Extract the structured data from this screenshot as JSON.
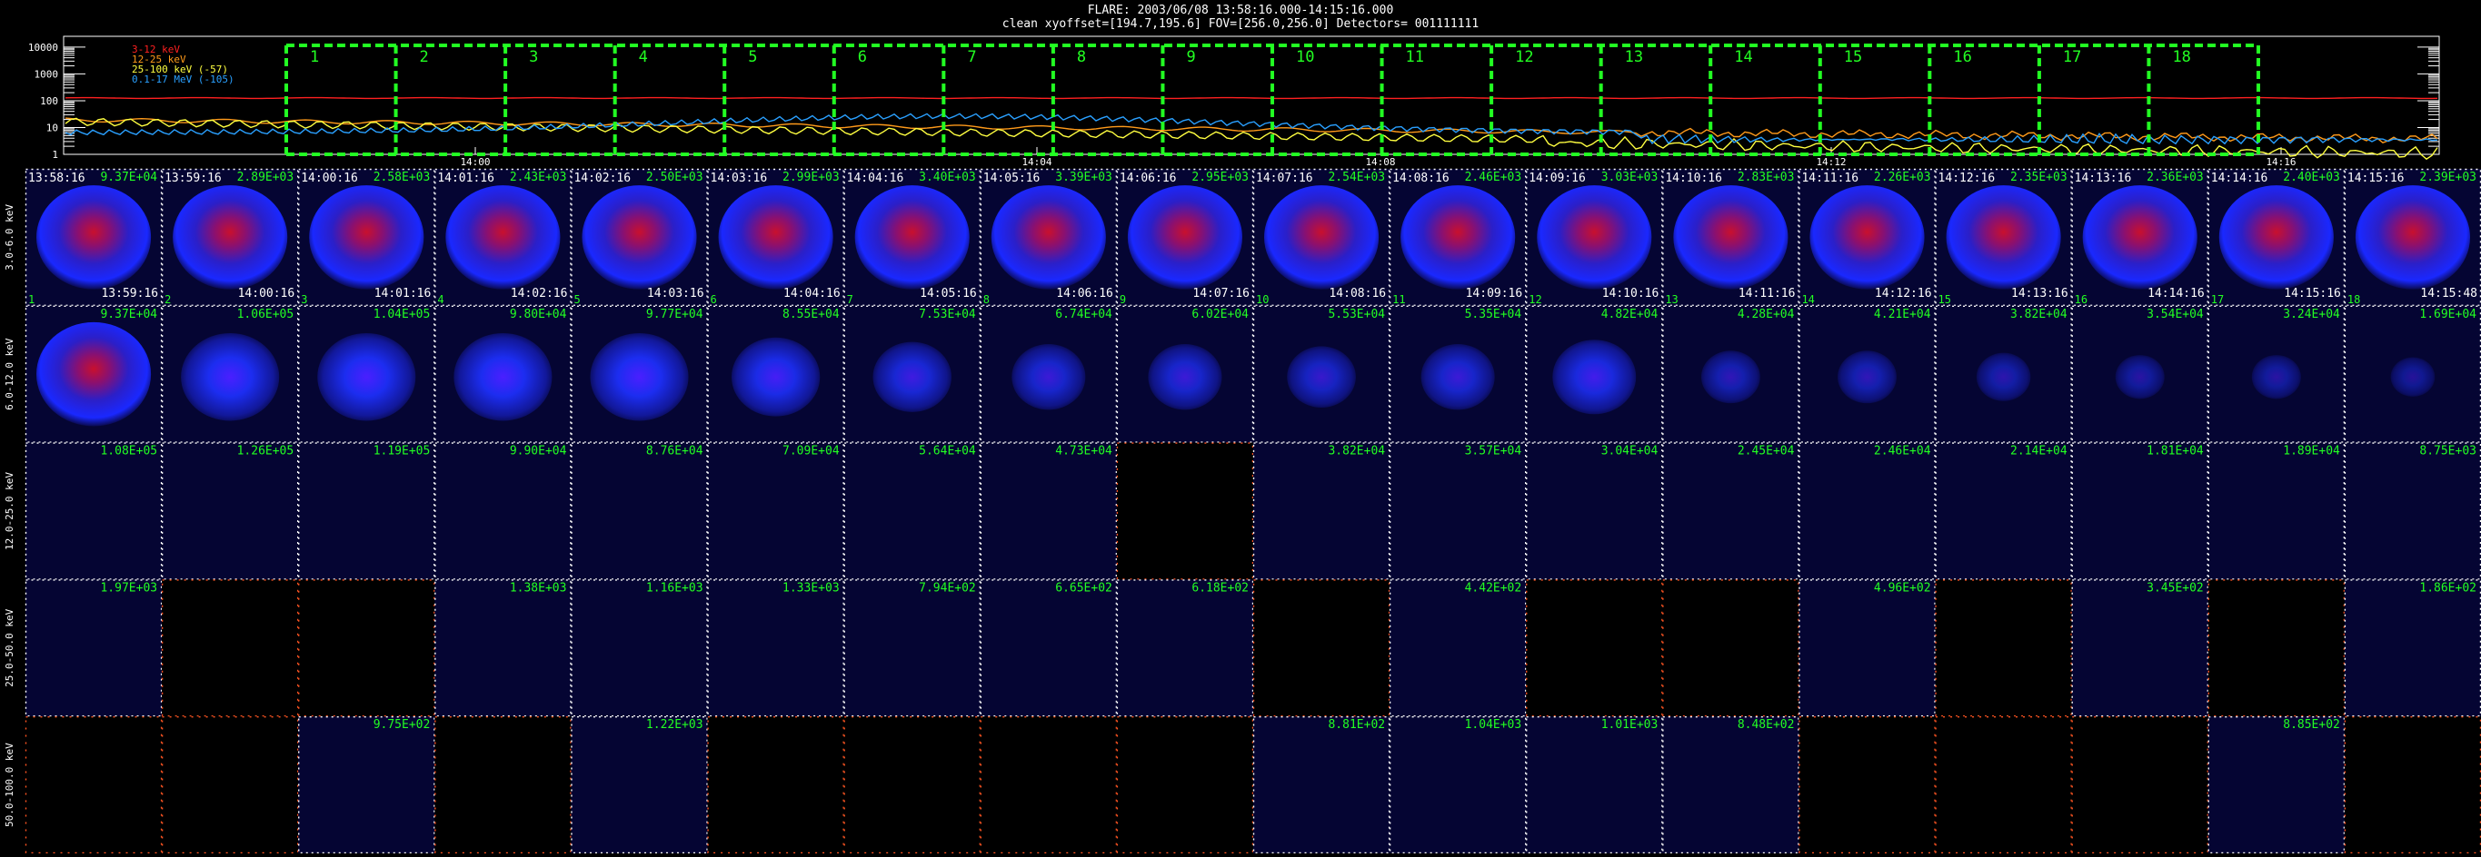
{
  "header": {
    "title_line": "FLARE: 2003/06/08 13:58:16.000-14:15:16.000",
    "info_line": "clean    xyoffset=[194.7,195.6]    FOV=[256.0,256.0]    Detectors= 001111111"
  },
  "lightcurve": {
    "y_ticks": [
      "10000",
      "1000",
      "100",
      "10",
      "1"
    ],
    "x_ticks": [
      "14:00",
      "14:04",
      "14:08",
      "14:12",
      "14:16"
    ],
    "legend": [
      {
        "label": "3-12 keV",
        "color": "#ff2020"
      },
      {
        "label": "12-25 keV",
        "color": "#ff9a1a"
      },
      {
        "label": "25-100 keV (-57)",
        "color": "#ffff40"
      },
      {
        "label": "0.1-17 MeV (-105)",
        "color": "#2aa0ff"
      }
    ],
    "interval_labels": [
      "1",
      "2",
      "3",
      "4",
      "5",
      "6",
      "7",
      "8",
      "9",
      "10",
      "11",
      "12",
      "13",
      "14",
      "15",
      "16",
      "17",
      "18"
    ],
    "interval_color": "#22ff22"
  },
  "grid": {
    "frame_color": "#ffffff",
    "value_color": "#22ff22",
    "empty_frame_color": "#ff5522",
    "start_times": [
      "13:58:16",
      "13:59:16",
      "14:00:16",
      "14:01:16",
      "14:02:16",
      "14:03:16",
      "14:04:16",
      "14:05:16",
      "14:06:16",
      "14:07:16",
      "14:08:16",
      "14:09:16",
      "14:10:16",
      "14:11:16",
      "14:12:16",
      "14:13:16",
      "14:14:16",
      "14:15:16"
    ],
    "end_times": [
      "13:59:16",
      "14:00:16",
      "14:01:16",
      "14:02:16",
      "14:03:16",
      "14:04:16",
      "14:05:16",
      "14:06:16",
      "14:07:16",
      "14:08:16",
      "14:09:16",
      "14:10:16",
      "14:11:16",
      "14:12:16",
      "14:13:16",
      "14:14:16",
      "14:15:16",
      "14:15:48"
    ],
    "rows": [
      {
        "label": "3.0-6.0 keV",
        "cells": [
          {
            "v": "9.37E+04",
            "brightness": 1.0
          },
          {
            "v": "2.89E+03",
            "brightness": 1.0
          },
          {
            "v": "2.58E+03",
            "brightness": 1.0
          },
          {
            "v": "2.43E+03",
            "brightness": 1.0
          },
          {
            "v": "2.50E+03",
            "brightness": 1.0
          },
          {
            "v": "2.99E+03",
            "brightness": 1.0
          },
          {
            "v": "3.40E+03",
            "brightness": 1.0
          },
          {
            "v": "3.39E+03",
            "brightness": 1.0
          },
          {
            "v": "2.95E+03",
            "brightness": 1.0
          },
          {
            "v": "2.54E+03",
            "brightness": 1.0
          },
          {
            "v": "2.46E+03",
            "brightness": 1.0
          },
          {
            "v": "3.03E+03",
            "brightness": 1.0
          },
          {
            "v": "2.83E+03",
            "brightness": 1.0
          },
          {
            "v": "2.26E+03",
            "brightness": 1.0
          },
          {
            "v": "2.35E+03",
            "brightness": 1.0
          },
          {
            "v": "2.36E+03",
            "brightness": 1.0
          },
          {
            "v": "2.40E+03",
            "brightness": 1.0
          },
          {
            "v": "2.39E+03",
            "brightness": 1.0
          }
        ]
      },
      {
        "label": "6.0-12.0 keV",
        "cells": [
          {
            "v": "9.37E+04",
            "brightness": 0.95
          },
          {
            "v": "1.06E+05",
            "brightness": 0.85
          },
          {
            "v": "1.04E+05",
            "brightness": 0.8
          },
          {
            "v": "9.80E+04",
            "brightness": 0.75
          },
          {
            "v": "9.77E+04",
            "brightness": 0.7
          },
          {
            "v": "8.55E+04",
            "brightness": 0.6
          },
          {
            "v": "7.53E+04",
            "brightness": 0.5
          },
          {
            "v": "6.74E+04",
            "brightness": 0.45
          },
          {
            "v": "6.02E+04",
            "brightness": 0.45
          },
          {
            "v": "5.53E+04",
            "brightness": 0.4
          },
          {
            "v": "5.35E+04",
            "brightness": 0.45
          },
          {
            "v": "4.82E+04",
            "brightness": 0.55
          },
          {
            "v": "4.28E+04",
            "brightness": 0.3
          },
          {
            "v": "4.21E+04",
            "brightness": 0.3
          },
          {
            "v": "3.82E+04",
            "brightness": 0.25
          },
          {
            "v": "3.54E+04",
            "brightness": 0.2
          },
          {
            "v": "3.24E+04",
            "brightness": 0.2
          },
          {
            "v": "1.69E+04",
            "brightness": 0.15
          }
        ]
      },
      {
        "label": "12.0-25.0 keV",
        "cells": [
          {
            "v": "1.08E+05",
            "brightness": 0.08
          },
          {
            "v": "1.26E+05",
            "brightness": 0.08
          },
          {
            "v": "1.19E+05",
            "brightness": 0.08
          },
          {
            "v": "9.90E+04",
            "brightness": 0.06
          },
          {
            "v": "8.76E+04",
            "brightness": 0.06
          },
          {
            "v": "7.09E+04",
            "brightness": 0.06
          },
          {
            "v": "5.64E+04",
            "brightness": 0.06
          },
          {
            "v": "4.73E+04",
            "brightness": 0.06
          },
          {
            "v": "",
            "brightness": 0
          },
          {
            "v": "3.82E+04",
            "brightness": 0.06
          },
          {
            "v": "3.57E+04",
            "brightness": 0.06
          },
          {
            "v": "3.04E+04",
            "brightness": 0.06
          },
          {
            "v": "2.45E+04",
            "brightness": 0.06
          },
          {
            "v": "2.46E+04",
            "brightness": 0.06
          },
          {
            "v": "2.14E+04",
            "brightness": 0.06
          },
          {
            "v": "1.81E+04",
            "brightness": 0.06
          },
          {
            "v": "1.89E+04",
            "brightness": 0.06
          },
          {
            "v": "8.75E+03",
            "brightness": 0.06
          }
        ]
      },
      {
        "label": "25.0-50.0 keV",
        "cells": [
          {
            "v": "1.97E+03",
            "brightness": 0.06
          },
          {
            "v": "",
            "brightness": 0
          },
          {
            "v": "",
            "brightness": 0
          },
          {
            "v": "1.38E+03",
            "brightness": 0.06
          },
          {
            "v": "1.16E+03",
            "brightness": 0.06
          },
          {
            "v": "1.33E+03",
            "brightness": 0.06
          },
          {
            "v": "7.94E+02",
            "brightness": 0.06
          },
          {
            "v": "6.65E+02",
            "brightness": 0.06
          },
          {
            "v": "6.18E+02",
            "brightness": 0.06
          },
          {
            "v": "",
            "brightness": 0
          },
          {
            "v": "4.42E+02",
            "brightness": 0.06
          },
          {
            "v": "",
            "brightness": 0
          },
          {
            "v": "",
            "brightness": 0
          },
          {
            "v": "4.96E+02",
            "brightness": 0.06
          },
          {
            "v": "",
            "brightness": 0
          },
          {
            "v": "3.45E+02",
            "brightness": 0.06
          },
          {
            "v": "",
            "brightness": 0
          },
          {
            "v": "1.86E+02",
            "brightness": 0.06
          }
        ]
      },
      {
        "label": "50.0-100.0 keV",
        "cells": [
          {
            "v": "",
            "brightness": 0
          },
          {
            "v": "",
            "brightness": 0
          },
          {
            "v": "9.75E+02",
            "brightness": 0.06
          },
          {
            "v": "",
            "brightness": 0
          },
          {
            "v": "1.22E+03",
            "brightness": 0.06
          },
          {
            "v": "",
            "brightness": 0
          },
          {
            "v": "",
            "brightness": 0
          },
          {
            "v": "",
            "brightness": 0
          },
          {
            "v": "",
            "brightness": 0
          },
          {
            "v": "8.81E+02",
            "brightness": 0.06
          },
          {
            "v": "1.04E+03",
            "brightness": 0.06
          },
          {
            "v": "1.01E+03",
            "brightness": 0.06
          },
          {
            "v": "8.48E+02",
            "brightness": 0.06
          },
          {
            "v": "",
            "brightness": 0
          },
          {
            "v": "",
            "brightness": 0
          },
          {
            "v": "",
            "brightness": 0
          },
          {
            "v": "8.85E+02",
            "brightness": 0.06
          },
          {
            "v": ""
          }
        ]
      }
    ]
  }
}
